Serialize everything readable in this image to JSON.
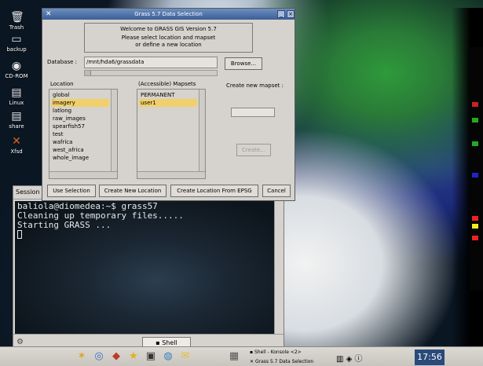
{
  "desktop_icons": [
    {
      "label": "Trash",
      "icon": "trash-icon"
    },
    {
      "label": "backup",
      "icon": "folder-icon"
    },
    {
      "label": "CD-ROM",
      "icon": "cdrom-icon"
    },
    {
      "label": "Linux",
      "icon": "drive-icon"
    },
    {
      "label": "share",
      "icon": "drive-icon"
    },
    {
      "label": "Xfsd",
      "icon": "x-icon"
    }
  ],
  "grass_dialog": {
    "title": "Grass 5.7 Data Selection",
    "welcome_line1": "Welcome to GRASS GIS Version 5.7",
    "welcome_line2": "Please select location and mapset",
    "welcome_line3": "or define a new location",
    "database_label": "Database :",
    "database_value": "/mnt/hda6/grassdata",
    "browse_label": "Browse...",
    "location_label": "Location",
    "mapsets_label": "(Accessible) Mapsets",
    "create_mapset_label": "Create new mapset :",
    "locations": [
      {
        "name": "global",
        "selected": false
      },
      {
        "name": "imagery",
        "selected": true
      },
      {
        "name": "latlong",
        "selected": false
      },
      {
        "name": "raw_images",
        "selected": false
      },
      {
        "name": "spearfish57",
        "selected": false
      },
      {
        "name": "test",
        "selected": false
      },
      {
        "name": "wafrica",
        "selected": false
      },
      {
        "name": "west_africa",
        "selected": false
      },
      {
        "name": "whole_image",
        "selected": false
      }
    ],
    "mapsets": [
      {
        "name": "PERMANENT",
        "selected": false
      },
      {
        "name": "user1",
        "selected": true
      }
    ],
    "new_mapset_value": "",
    "create_label": "Create...",
    "use_selection_label": "Use Selection",
    "create_new_location_label": "Create New Location",
    "create_location_epsg_label": "Create Location From EPSG",
    "cancel_label": "Cancel",
    "minimize_glyph": "_",
    "close_glyph": "×"
  },
  "konsole": {
    "tab_menu": "Session E",
    "terminal_lines": [
      "baliola@diomedea:~$ grass57",
      "Cleaning up temporary files.....",
      "Starting GRASS ..."
    ],
    "tab_label": "Shell"
  },
  "taskbar": {
    "tasks": [
      "Shell - Konsole <2>",
      "Grass 5.7 Data Selection"
    ],
    "clock": "17:56"
  },
  "colors": {
    "selection": "#f1d06b",
    "titlebar": "#3a5f96",
    "dialog_bg": "#d6d3ce"
  }
}
